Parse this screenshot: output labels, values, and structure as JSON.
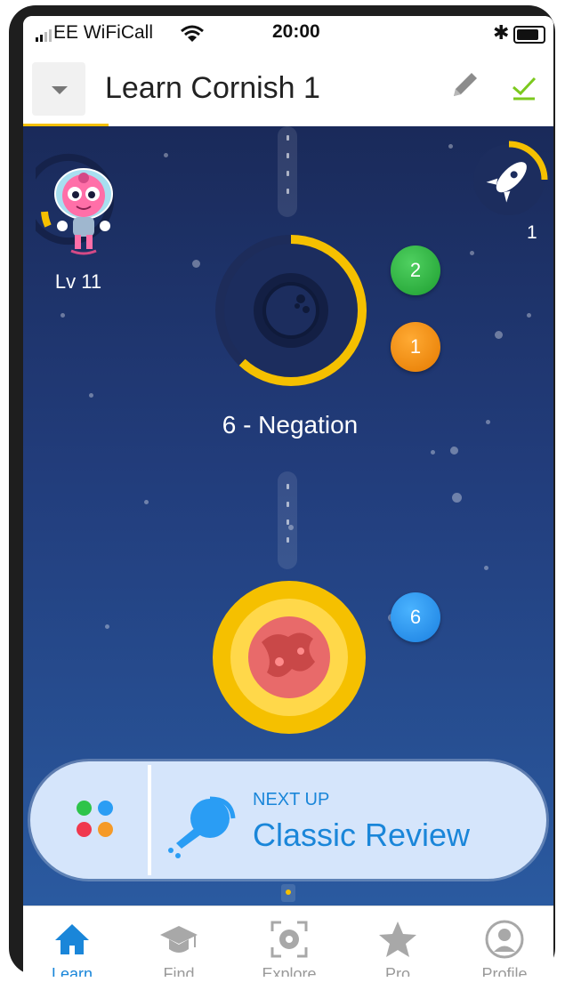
{
  "status_bar": {
    "carrier": "EE WiFiCall",
    "time": "20:00"
  },
  "header": {
    "course_title": "Learn Cornish 1"
  },
  "avatar": {
    "level": "Lv 11"
  },
  "rocket": {
    "count": "1"
  },
  "lesson": {
    "name": "6 - Negation",
    "badge_green": "2",
    "badge_orange": "1",
    "progress": 0.62
  },
  "next_lesson": {
    "badge_blue": "6"
  },
  "next_up": {
    "label": "NEXT UP",
    "title": "Classic Review"
  },
  "tabs": [
    {
      "label": "Learn",
      "icon": "home-icon",
      "active": true
    },
    {
      "label": "Find",
      "icon": "graduation-cap-icon",
      "active": false
    },
    {
      "label": "Explore",
      "icon": "camera-scan-icon",
      "active": false
    },
    {
      "label": "Pro",
      "icon": "star-icon",
      "active": false
    },
    {
      "label": "Profile",
      "icon": "profile-icon",
      "active": false
    }
  ],
  "colors": {
    "accent_yellow": "#f5c000",
    "accent_blue": "#1a86d9",
    "space_dark": "#1a2a5a",
    "space_light": "#2a5aa0"
  }
}
